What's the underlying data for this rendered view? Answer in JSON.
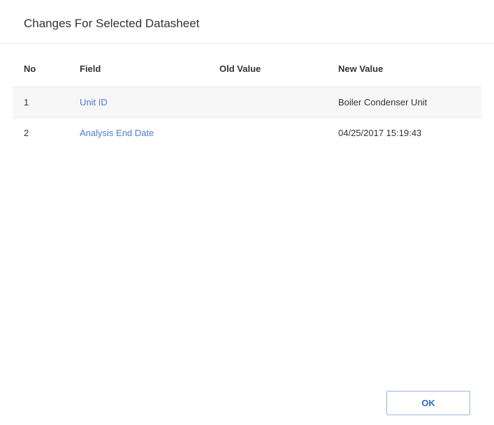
{
  "header": {
    "title": "Changes For Selected Datasheet"
  },
  "table": {
    "columns": {
      "no": "No",
      "field": "Field",
      "old": "Old Value",
      "new": "New Value"
    },
    "rows": [
      {
        "no": "1",
        "field": "Unit ID",
        "old": "",
        "new": "Boiler Condenser Unit"
      },
      {
        "no": "2",
        "field": "Analysis End Date",
        "old": "",
        "new": "04/25/2017 15:19:43"
      }
    ]
  },
  "footer": {
    "ok_label": "OK"
  }
}
